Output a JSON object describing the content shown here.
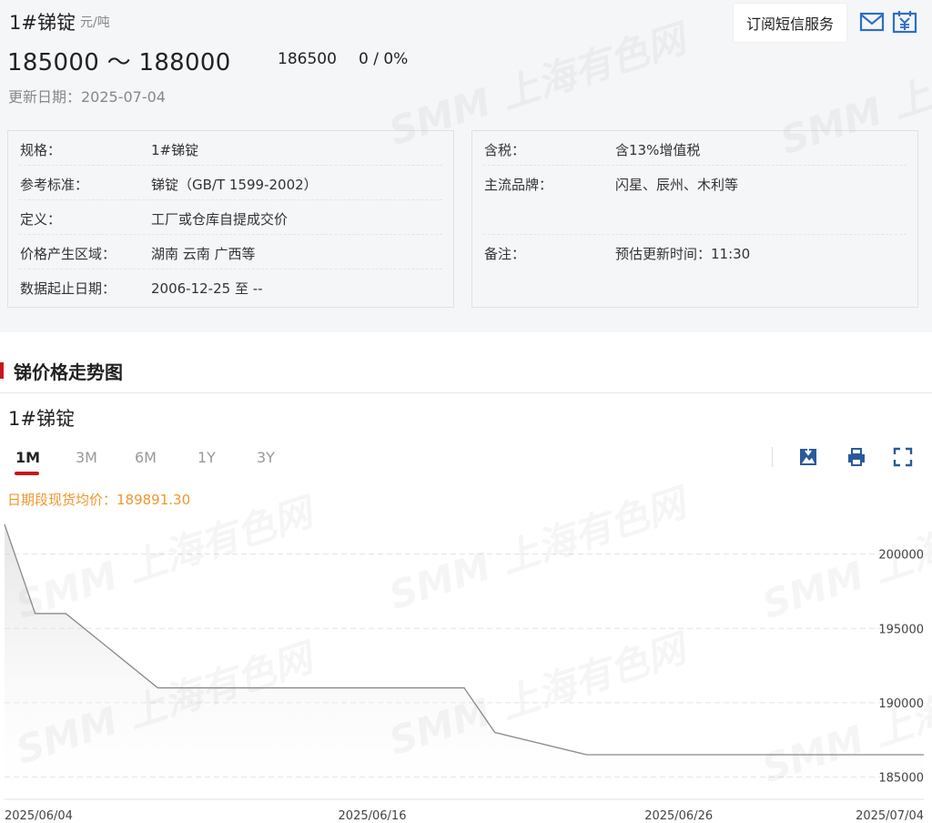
{
  "header": {
    "title": "1#锑锭",
    "unit": "元/吨",
    "price_range": "185000 ～ 188000",
    "mid_price": "186500",
    "change": "0 / 0%",
    "update_date": "更新日期：2025-07-04"
  },
  "actions": {
    "sms_label": "订阅短信服务",
    "mail_icon": "mail-icon",
    "yen_icon": "yen-calendar-icon"
  },
  "info_left": [
    {
      "key": "规格：",
      "value": "1#锑锭"
    },
    {
      "key": "参考标准：",
      "value": "锑锭（GB/T 1599-2002）"
    },
    {
      "key": "定义：",
      "value": "工厂或仓库自提成交价"
    },
    {
      "key": "价格产生区域：",
      "value": "湖南 云南 广西等"
    },
    {
      "key": "数据起止日期：",
      "value": "2006-12-25 至 --"
    }
  ],
  "info_right": [
    {
      "key": "含税：",
      "value": "含13%增值税"
    },
    {
      "key": "主流品牌：",
      "value": "闪星、辰州、木利等"
    },
    {
      "key": "备注：",
      "value": "预估更新时间：11:30"
    }
  ],
  "section": {
    "title": "锑价格走势图"
  },
  "chart_panel": {
    "title": "1#锑锭",
    "tabs": [
      "1M",
      "3M",
      "6M",
      "1Y",
      "3Y"
    ],
    "active_tab": "1M",
    "avg_text": "日期段现货均价：189891.30",
    "tools": [
      "download-image-icon",
      "print-icon",
      "fullscreen-icon"
    ]
  },
  "watermark": "SMM 上海有色网",
  "chart_data": {
    "type": "area",
    "title": "",
    "xlabel": "",
    "ylabel": "",
    "x_ticks": [
      "2025/06/04",
      "2025/06/16",
      "2025/06/26",
      "2025/07/04"
    ],
    "y_ticks": [
      185000,
      190000,
      195000,
      200000
    ],
    "ylim": [
      183500,
      202000
    ],
    "grid": true,
    "series": [
      {
        "x": [
          "2025/06/04",
          "2025/06/05",
          "2025/06/06",
          "2025/06/09",
          "2025/06/10",
          "2025/06/11",
          "2025/06/12",
          "2025/06/13",
          "2025/06/16",
          "2025/06/17",
          "2025/06/18",
          "2025/06/19",
          "2025/06/20",
          "2025/06/23",
          "2025/06/24",
          "2025/06/25",
          "2025/06/26",
          "2025/06/27",
          "2025/06/30",
          "2025/07/01",
          "2025/07/02",
          "2025/07/03",
          "2025/07/04"
        ],
        "values": [
          202000,
          196000,
          196000,
          191000,
          191000,
          191000,
          191000,
          191000,
          191000,
          191000,
          191000,
          191000,
          188000,
          186500,
          186500,
          186500,
          186500,
          186500,
          186500,
          186500,
          186500,
          186500,
          186500
        ]
      }
    ]
  }
}
